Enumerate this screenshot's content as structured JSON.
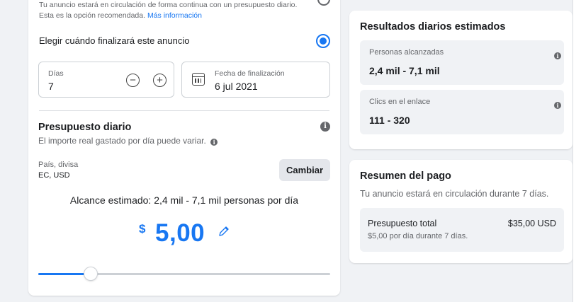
{
  "schedule": {
    "continuous_note": "Tu anuncio estará en circulación de forma continua con un presupuesto diario.",
    "recommended_note": "Esta es la opción recomendada.",
    "more_info_link": "Más información",
    "end_option_label": "Elegir cuándo finalizará este anuncio",
    "days_label": "Días",
    "days_value": "7",
    "end_date_label": "Fecha de finalización",
    "end_date_value": "6 jul 2021"
  },
  "budget": {
    "title": "Presupuesto diario",
    "subtitle": "El importe real gastado por día puede variar.",
    "country_label": "País, divisa",
    "country_value": "EC, USD",
    "change_button": "Cambiar",
    "estimated_reach": "Alcance estimado: 2,4 mil - 7,1 mil personas por día",
    "currency_symbol": "$",
    "amount": "5,00",
    "slider_fraction": 0.18
  },
  "results": {
    "title": "Resultados diarios estimados",
    "people_label": "Personas alcanzadas",
    "people_value": "2,4 mil - 7,1 mil",
    "clicks_label": "Clics en el enlace",
    "clicks_value": "111 - 320"
  },
  "payment": {
    "title": "Resumen del pago",
    "subtitle": "Tu anuncio estará en circulación durante 7 días.",
    "total_label": "Presupuesto total",
    "total_amount": "$35,00 USD",
    "total_detail": "$5,00 por día durante 7 días."
  },
  "icons": {
    "info": "info-icon",
    "calendar": "calendar-icon",
    "pencil": "pencil-icon",
    "minus": "minus-icon",
    "plus": "plus-icon"
  },
  "colors": {
    "accent": "#1877f2",
    "muted_text": "#65676b",
    "box_bg": "#f0f2f5"
  }
}
